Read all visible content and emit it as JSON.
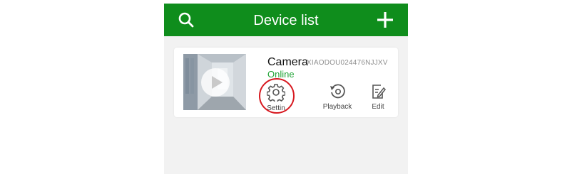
{
  "header": {
    "title": "Device list",
    "search_icon": "search-icon",
    "add_icon": "plus-icon",
    "background": "#0f8d1c"
  },
  "device": {
    "name": "Camera",
    "serial": "XIAODOU024476NJJXV",
    "status": "Online",
    "status_color": "#21a336",
    "actions": [
      {
        "label": "Settin",
        "icon": "gear-icon"
      },
      {
        "label": "Playback",
        "icon": "playback-icon"
      },
      {
        "label": "Edit",
        "icon": "edit-icon"
      }
    ]
  },
  "annotation": {
    "highlight_color": "#d71920",
    "highlight_target": "settings"
  }
}
